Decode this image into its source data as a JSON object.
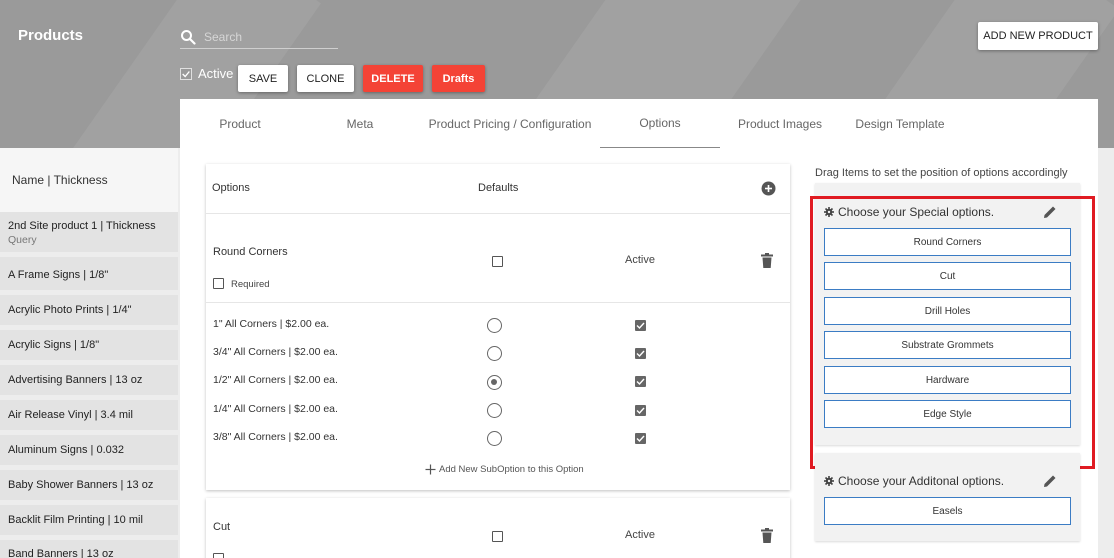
{
  "header": {
    "title": "Products",
    "search_placeholder": "Search",
    "active_label": "Active",
    "active_checked": true,
    "buttons": {
      "save": "SAVE",
      "clone": "CLONE",
      "delete": "DELETE",
      "drafts": "Drafts",
      "add_new": "ADD NEW PRODUCT"
    },
    "colors": {
      "danger": "#f44336",
      "highlight": "#e01b22",
      "accent_border": "#3b7cc4"
    }
  },
  "tabs": [
    {
      "label": "Product"
    },
    {
      "label": "Meta"
    },
    {
      "label": "Product Pricing / Configuration"
    },
    {
      "label": "Options",
      "selected": true
    },
    {
      "label": "Product Images"
    },
    {
      "label": "Design Template"
    }
  ],
  "product_list": {
    "header": "Name | Thickness",
    "items": [
      {
        "name": "2nd Site product 1 | Thickness",
        "sub": "Query"
      },
      {
        "name": "A Frame Signs | 1/8\""
      },
      {
        "name": "Acrylic Photo Prints | 1/4\""
      },
      {
        "name": "Acrylic Signs | 1/8\""
      },
      {
        "name": "Advertising Banners | 13 oz"
      },
      {
        "name": "Air Release Vinyl | 3.4 mil"
      },
      {
        "name": "Aluminum Signs | 0.032"
      },
      {
        "name": "Baby Shower Banners | 13 oz"
      },
      {
        "name": "Backlit Film Printing | 10 mil"
      },
      {
        "name": "Band Banners | 13 oz"
      }
    ]
  },
  "options_table": {
    "col_options": "Options",
    "col_defaults": "Defaults",
    "groups": [
      {
        "name": "Round Corners",
        "required_label": "Required",
        "status": "Active",
        "suboptions": [
          {
            "label": "1\" All Corners | $2.00 ea.",
            "default": false,
            "active": true
          },
          {
            "label": "3/4\" All Corners | $2.00 ea.",
            "default": false,
            "active": true
          },
          {
            "label": "1/2\" All Corners | $2.00 ea.",
            "default": true,
            "active": true
          },
          {
            "label": "1/4\" All Corners | $2.00 ea.",
            "default": false,
            "active": true
          },
          {
            "label": "3/8\" All Corners | $2.00 ea.",
            "default": false,
            "active": true
          }
        ],
        "add_suboption_label": "Add New SubOption to this Option"
      },
      {
        "name": "Cut",
        "status": "Active"
      }
    ]
  },
  "right_panel": {
    "note": "Drag Items to set the position of options accordingly",
    "groups": [
      {
        "title": "Choose your Special options.",
        "items": [
          "Round Corners",
          "Cut",
          "Drill Holes",
          "Substrate Grommets",
          "Hardware",
          "Edge Style"
        ]
      },
      {
        "title": "Choose your Additonal options.",
        "items": [
          "Easels"
        ]
      }
    ]
  }
}
